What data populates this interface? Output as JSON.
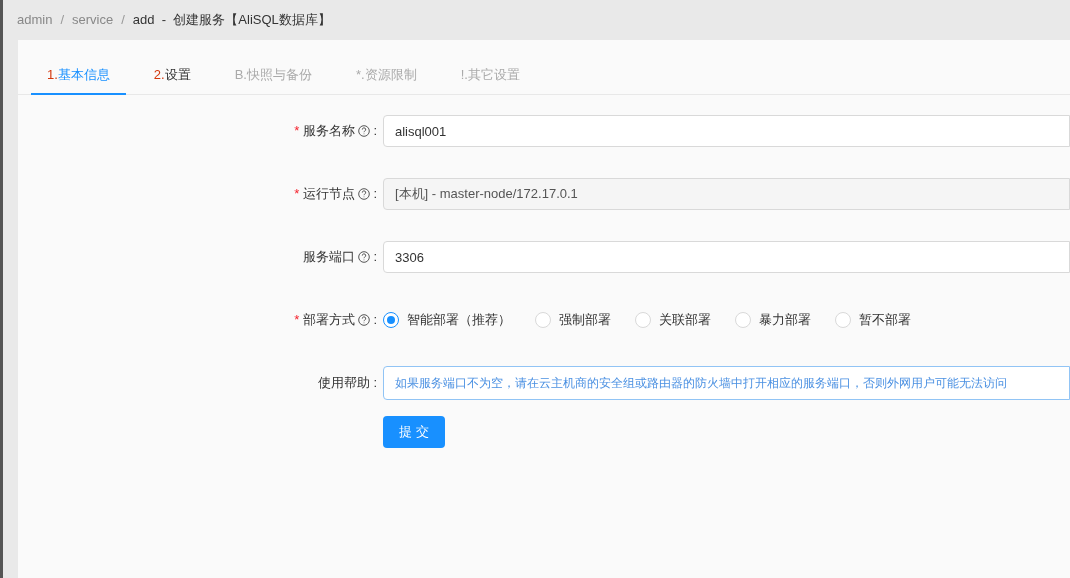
{
  "breadcrumb": [
    {
      "label": "admin",
      "current": false
    },
    {
      "separator": "/",
      "label": "service",
      "current": false
    },
    {
      "separator": "/",
      "label": "add  -  创建服务【AliSQL数据库】",
      "current": true
    }
  ],
  "tabs": [
    {
      "prefix": "1.",
      "label": "基本信息",
      "prefix_marked": true,
      "selected": true,
      "disabled": false
    },
    {
      "prefix": "2.",
      "label": "设置",
      "prefix_marked": true,
      "selected": false,
      "disabled": false
    },
    {
      "prefix": "B.",
      "label": "快照与备份",
      "prefix_marked": false,
      "selected": false,
      "disabled": true
    },
    {
      "prefix": "*.",
      "label": "资源限制",
      "prefix_marked": false,
      "selected": false,
      "disabled": true
    },
    {
      "prefix": "!.",
      "label": "其它设置",
      "prefix_marked": false,
      "selected": false,
      "disabled": true
    }
  ],
  "form": [
    {
      "kind": "input",
      "required_mark": "*",
      "label": "服务名称",
      "help_icon": true,
      "colon": ":",
      "value": "alisql001",
      "disabled": false
    },
    {
      "kind": "input",
      "required_mark": "*",
      "label": "运行节点",
      "help_icon": true,
      "colon": ":",
      "value": "[本机] - master-node/172.17.0.1",
      "disabled": true
    },
    {
      "kind": "input",
      "label": "服务端口",
      "help_icon": true,
      "colon": ":",
      "value": "3306",
      "disabled": false
    },
    {
      "kind": "radio",
      "required_mark": "*",
      "label": "部署方式",
      "help_icon": true,
      "colon": ":",
      "options": [
        {
          "label": "智能部署（推荐）",
          "selected": true
        },
        {
          "label": "强制部署",
          "selected": false
        },
        {
          "label": "关联部署",
          "selected": false
        },
        {
          "label": "暴力部署",
          "selected": false
        },
        {
          "label": "暂不部署",
          "selected": false
        }
      ]
    },
    {
      "kind": "help",
      "label": "使用帮助",
      "colon": ":",
      "text": "如果服务端口不为空，请在云主机商的安全组或路由器的防火墙中打开相应的服务端口，否则外网用户可能无法访问"
    }
  ],
  "submit": "提 交"
}
